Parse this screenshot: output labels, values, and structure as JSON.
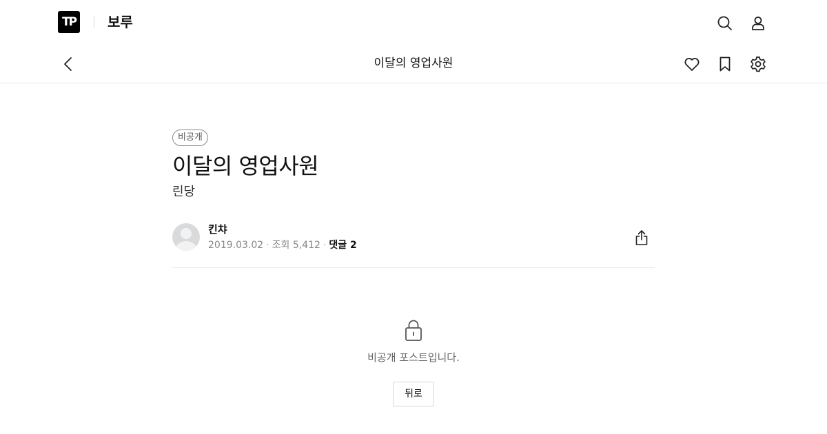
{
  "header": {
    "logo_text": "TP",
    "blog_name": "보루",
    "icons": [
      "search-icon",
      "user-icon"
    ]
  },
  "subheader": {
    "title": "이달의 영업사원",
    "icons": [
      "back-arrow-icon",
      "heart-icon",
      "bookmark-icon",
      "gear-icon"
    ]
  },
  "post": {
    "badge": "비공개",
    "title": "이달의 영업사원",
    "subtitle": "린당",
    "author": "킨챠",
    "date": "2019.03.02",
    "views": "조회 5,412",
    "comments": "댓글 2"
  },
  "locked": {
    "message": "비공개 포스트입니다.",
    "back_label": "뒤로"
  },
  "colors": {
    "text": "#111111",
    "muted": "#888888",
    "border": "#e6e6e6",
    "logo_bg": "#000000"
  }
}
